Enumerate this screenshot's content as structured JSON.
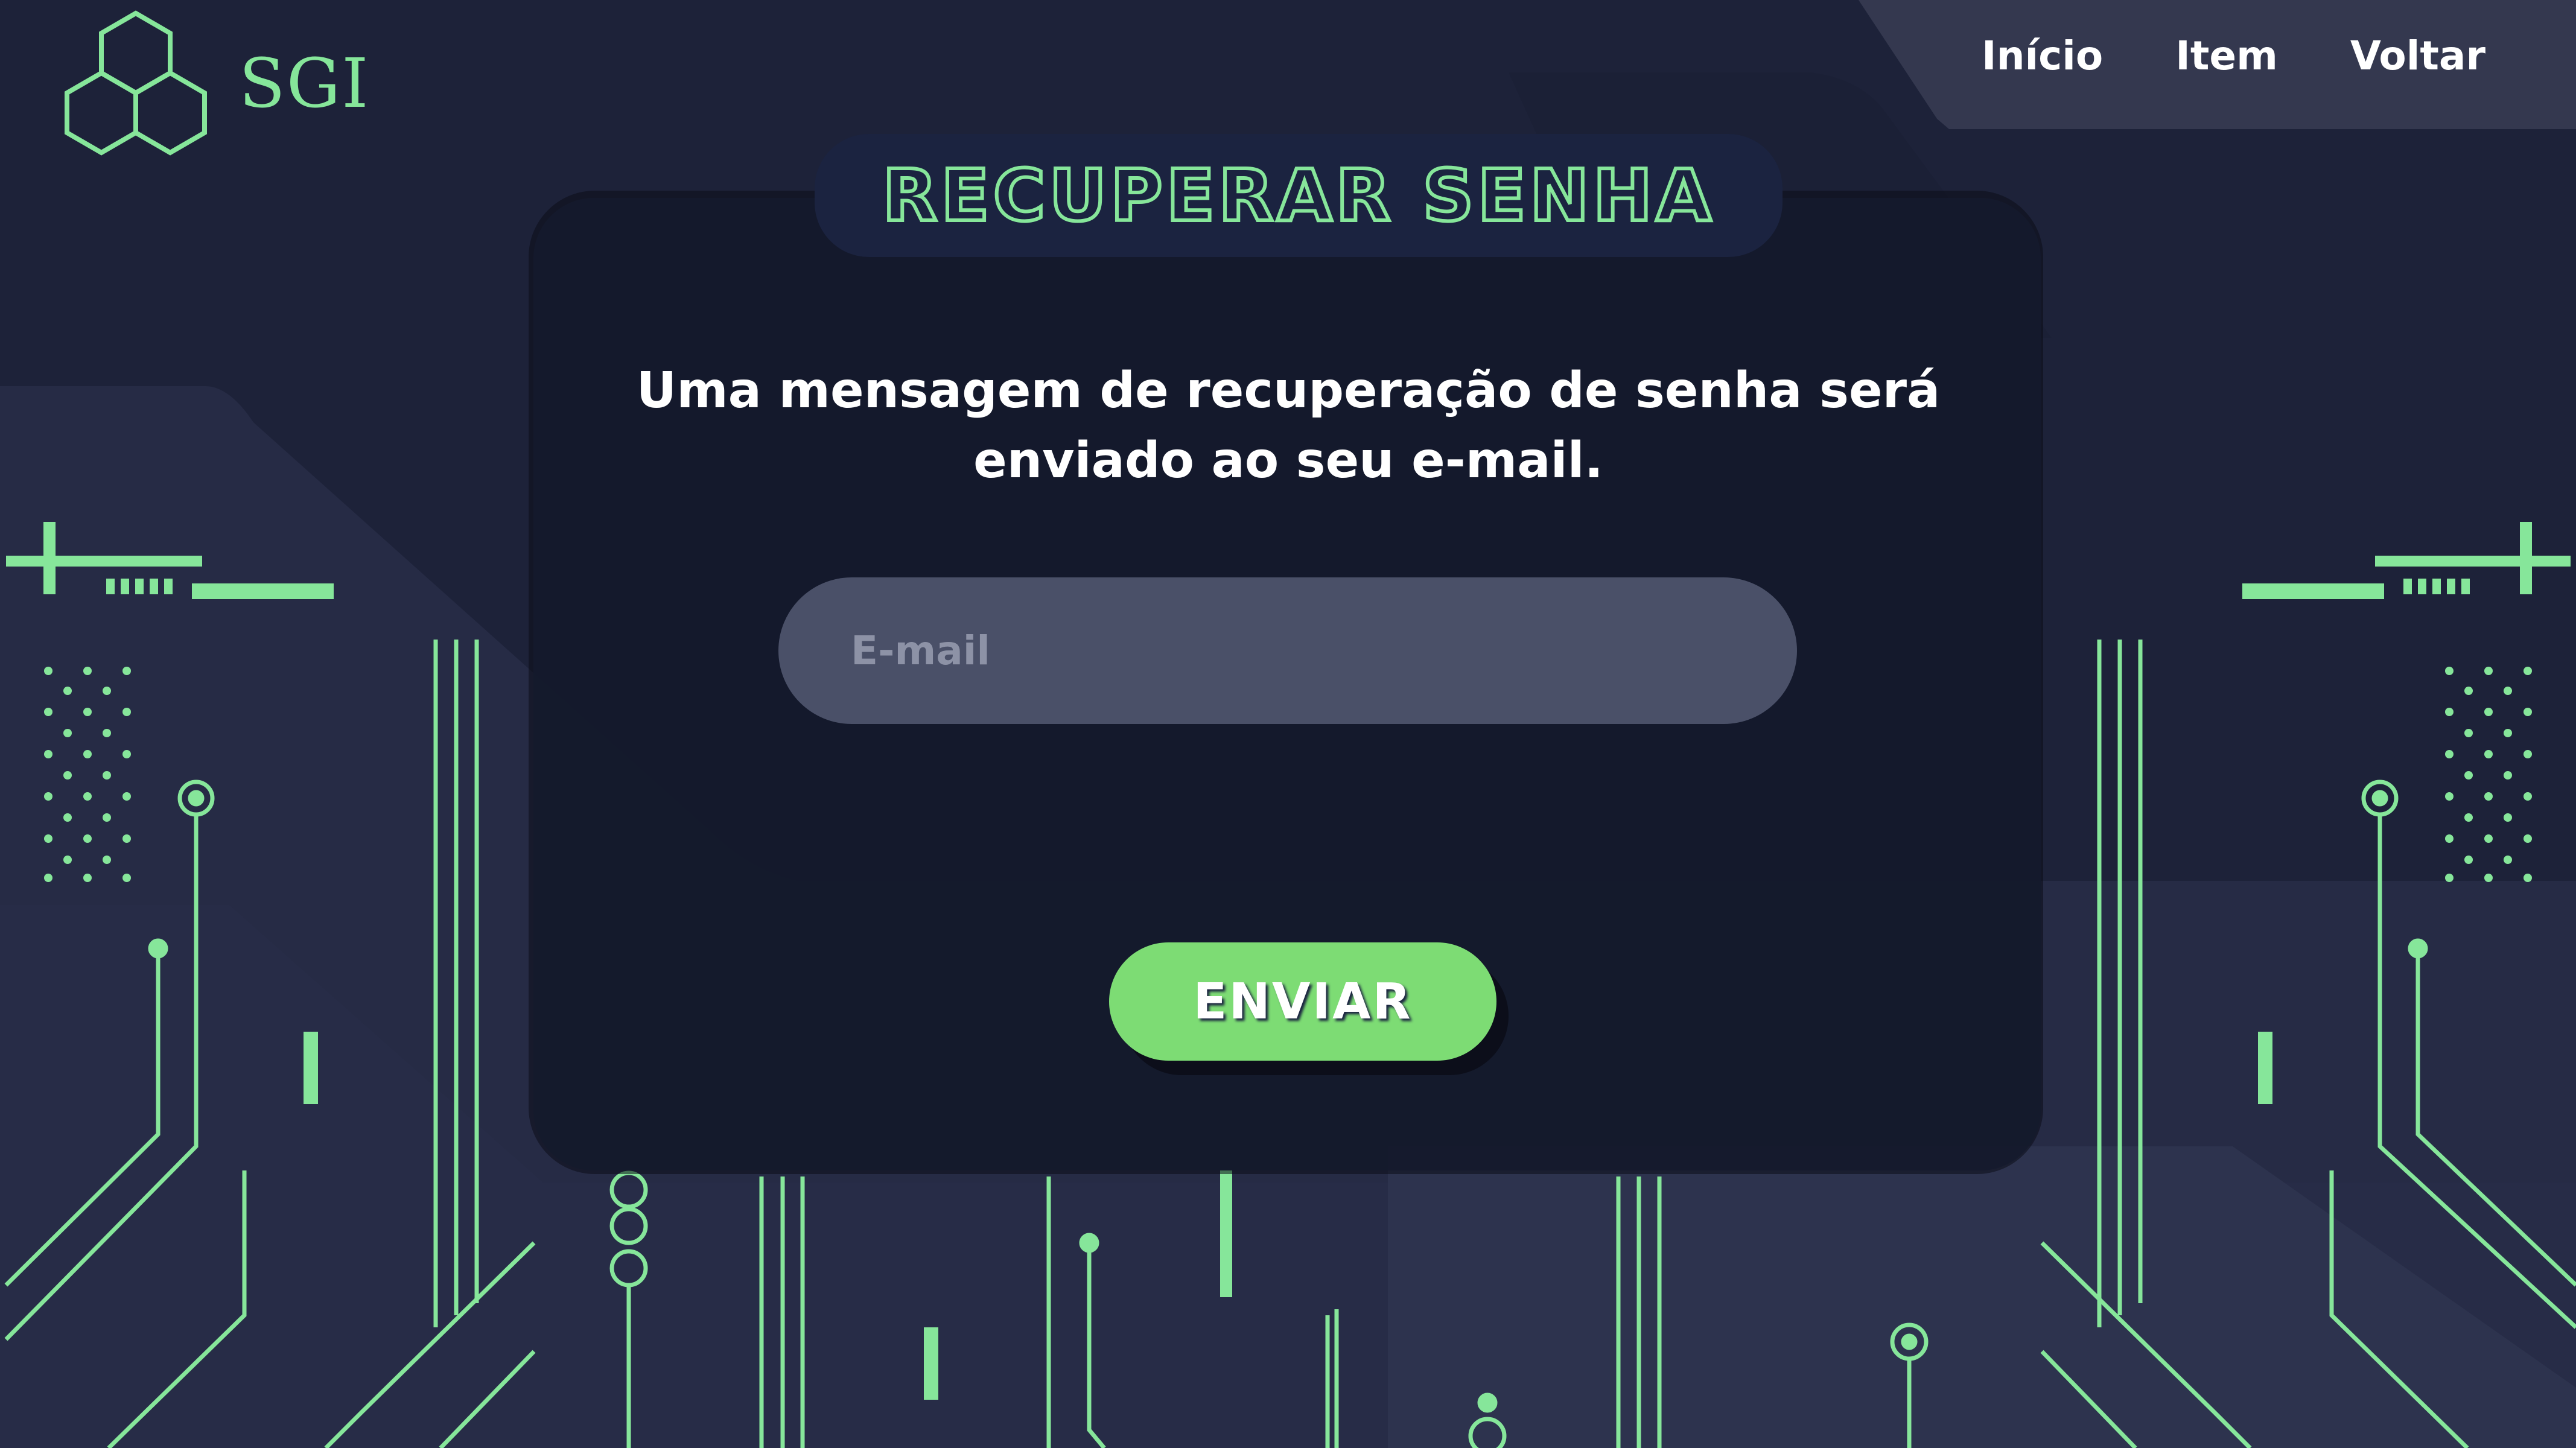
{
  "brand": {
    "name": "SGI",
    "icon": "hexagon-cluster-icon"
  },
  "nav": {
    "items": [
      "Início",
      "Item",
      "Voltar"
    ]
  },
  "form": {
    "title": "RECUPERAR SENHA",
    "message": "Uma mensagem de recuperação de senha será enviado ao seu e-mail.",
    "email_placeholder": "E-mail",
    "email_value": "",
    "submit_label": "ENVIAR"
  },
  "colors": {
    "background": "#1d2239",
    "card": "#151a2d",
    "accent_green": "#86e69a",
    "button_green": "#7ddc74",
    "input_bg": "#4a5068",
    "nav_panel": "#34384f"
  }
}
